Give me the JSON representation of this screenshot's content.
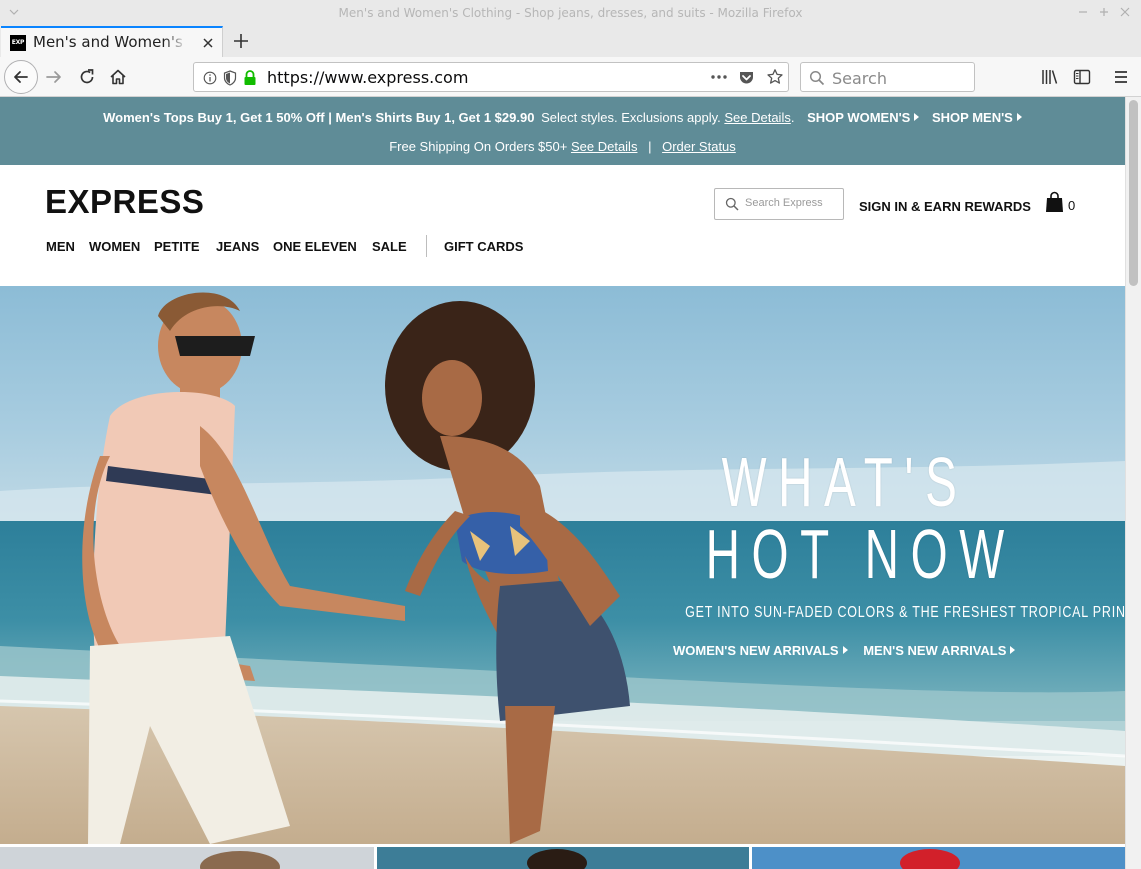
{
  "window": {
    "title": "Men's and Women's Clothing - Shop jeans, dresses, and suits - Mozilla Firefox"
  },
  "tab": {
    "favicon_text": "EXP",
    "title": "Men's and Women's Clothing - Shop jeans, dresses, and suits"
  },
  "toolbar": {
    "url": "https://www.express.com",
    "search_placeholder": "Search"
  },
  "promo": {
    "women_offer": "Women's Tops Buy 1, Get 1 50% Off",
    "separator": "|",
    "men_offer": "Men's Shirts Buy 1, Get 1 $29.90",
    "exclusions": "Select styles. Exclusions apply.",
    "see_details": "See Details",
    "period": ".",
    "shop_women": "SHOP WOMEN'S",
    "shop_men": "SHOP MEN'S",
    "shipping": "Free Shipping On Orders $50+",
    "shipping_details": "See Details",
    "order_status": "Order Status"
  },
  "header": {
    "logo": "EXPRESS",
    "search_placeholder": "Search Express",
    "signin": "SIGN IN & EARN REWARDS",
    "bag_count": "0",
    "nav": [
      "MEN",
      "WOMEN",
      "PETITE",
      "JEANS",
      "ONE ELEVEN",
      "SALE",
      "GIFT CARDS"
    ]
  },
  "hero": {
    "headline_line1": "WHAT'S",
    "headline_line2": "HOT NOW",
    "subhead": "GET INTO SUN-FADED COLORS & THE FRESHEST TROPICAL PRINTS",
    "cta_women": "WOMEN'S NEW ARRIVALS",
    "cta_men": "MEN'S NEW ARRIVALS"
  },
  "colors": {
    "promo_bar": "#5f8c97",
    "tab_accent": "#0a84ff",
    "lock_green": "#12bc00"
  }
}
